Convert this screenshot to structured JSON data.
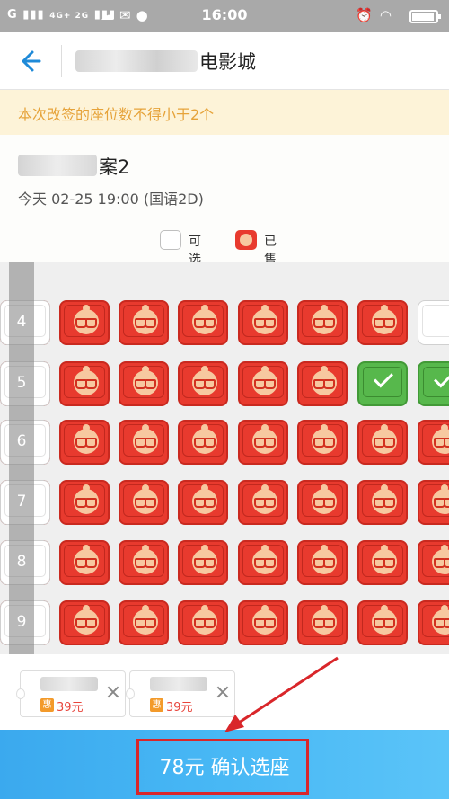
{
  "status_bar": {
    "signal_text": "G",
    "network_text": "4G+ 2G",
    "time": "16:00"
  },
  "header": {
    "title_suffix": "电影城"
  },
  "notice": "本次改签的座位数不得小于2个",
  "movie": {
    "title_suffix": "案2",
    "showtime": "今天 02-25  19:00 (国语2D)"
  },
  "legend": {
    "available": "可选",
    "sold": "已售"
  },
  "seat_rows": [
    {
      "label": "4",
      "seats": [
        "sold",
        "sold",
        "sold",
        "sold",
        "sold",
        "sold",
        "available",
        "available"
      ]
    },
    {
      "label": "5",
      "seats": [
        "sold",
        "sold",
        "sold",
        "sold",
        "sold",
        "selected",
        "selected",
        "available"
      ]
    },
    {
      "label": "6",
      "seats": [
        "sold",
        "sold",
        "sold",
        "sold",
        "sold",
        "sold",
        "sold",
        "available"
      ]
    },
    {
      "label": "7",
      "seats": [
        "sold",
        "sold",
        "sold",
        "sold",
        "sold",
        "sold",
        "sold",
        "available"
      ]
    },
    {
      "label": "8",
      "seats": [
        "sold",
        "sold",
        "sold",
        "sold",
        "sold",
        "sold",
        "sold",
        "available"
      ]
    },
    {
      "label": "9",
      "seats": [
        "sold",
        "sold",
        "sold",
        "sold",
        "sold",
        "sold",
        "sold",
        "available"
      ]
    }
  ],
  "selected_tickets": [
    {
      "badge": "惠",
      "price": "39元"
    },
    {
      "badge": "惠",
      "price": "39元"
    }
  ],
  "confirm_button": "78元 确认选座",
  "colors": {
    "sold": "#e83a2e",
    "selected": "#57b84c",
    "confirm_bar": "#48b8f5",
    "notice_text": "#e6a33a",
    "annotation": "#d9262a"
  }
}
